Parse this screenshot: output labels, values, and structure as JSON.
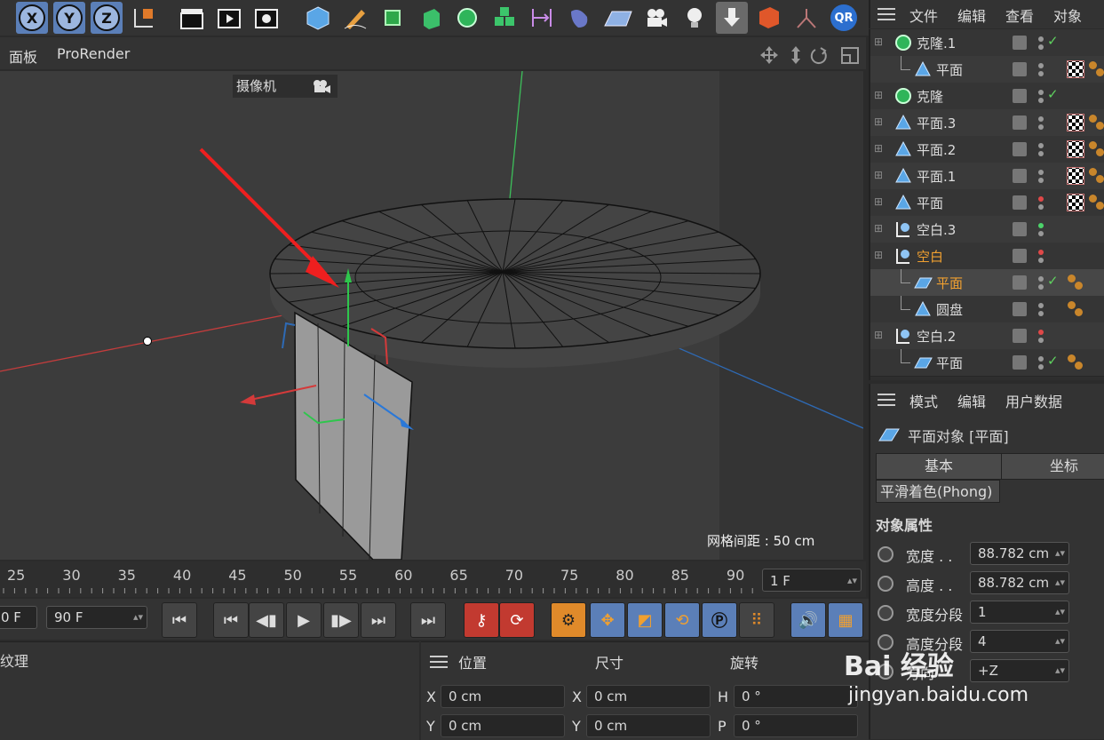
{
  "toolbar": {
    "axis_x": "X",
    "axis_y": "Y",
    "axis_z": "Z",
    "qr_label": "QR"
  },
  "viewport": {
    "menu": [
      "面板",
      "ProRender"
    ],
    "camera_label": "摄像机",
    "grid_spacing": "网格间距 : 50 cm"
  },
  "timeline": {
    "ticks": [
      "25",
      "30",
      "35",
      "40",
      "45",
      "50",
      "55",
      "60",
      "65",
      "70",
      "75",
      "80",
      "85",
      "90"
    ],
    "current_frame": "1 F",
    "start_frame": "0 F",
    "end_frame": "90 F"
  },
  "bottom_left": {
    "label": "纹理"
  },
  "coords": {
    "headers": [
      "位置",
      "尺寸",
      "旋转"
    ],
    "rows": [
      {
        "pos_label": "X",
        "pos": "0 cm",
        "size_label": "X",
        "size": "0 cm",
        "rot_label": "H",
        "rot": "0 °"
      },
      {
        "pos_label": "Y",
        "pos": "0 cm",
        "size_label": "Y",
        "size": "0 cm",
        "rot_label": "P",
        "rot": "0 °"
      }
    ]
  },
  "object_manager": {
    "menu": [
      "文件",
      "编辑",
      "查看",
      "对象"
    ],
    "items": [
      {
        "name": "克隆.1",
        "indent": 0,
        "icon": "cloner-icon",
        "active": false
      },
      {
        "name": "平面",
        "indent": 1,
        "icon": "plane-icon",
        "active": false
      },
      {
        "name": "克隆",
        "indent": 0,
        "icon": "cloner-icon",
        "active": false
      },
      {
        "name": "平面.3",
        "indent": 0,
        "icon": "plane-icon",
        "active": false
      },
      {
        "name": "平面.2",
        "indent": 0,
        "icon": "plane-icon",
        "active": false
      },
      {
        "name": "平面.1",
        "indent": 0,
        "icon": "plane-icon",
        "active": false
      },
      {
        "name": "平面",
        "indent": 0,
        "icon": "plane-icon",
        "active": false
      },
      {
        "name": "空白.3",
        "indent": 0,
        "icon": "null-icon",
        "active": false
      },
      {
        "name": "空白",
        "indent": 0,
        "icon": "null-icon",
        "active": true
      },
      {
        "name": "平面",
        "indent": 1,
        "icon": "plane-poly-icon",
        "active": true
      },
      {
        "name": "圆盘",
        "indent": 1,
        "icon": "plane-icon",
        "active": false
      },
      {
        "name": "空白.2",
        "indent": 0,
        "icon": "null-icon",
        "active": false
      },
      {
        "name": "平面",
        "indent": 1,
        "icon": "plane-poly-icon",
        "active": false
      }
    ]
  },
  "attribute_manager": {
    "menu": [
      "模式",
      "编辑",
      "用户数据"
    ],
    "object_title": "平面对象 [平面]",
    "tabs": [
      "基本",
      "坐标"
    ],
    "subtab": "平滑着色(Phong)",
    "section": "对象属性",
    "fields": [
      {
        "label": "宽度 . .",
        "value": "88.782 cm"
      },
      {
        "label": "高度 . .",
        "value": "88.782 cm"
      },
      {
        "label": "宽度分段",
        "value": "1"
      },
      {
        "label": "高度分段",
        "value": "4"
      },
      {
        "label": "方向",
        "value": "+Z"
      }
    ]
  },
  "watermark": {
    "brand": "Bai 经验",
    "url": "jingyan.baidu.com"
  }
}
